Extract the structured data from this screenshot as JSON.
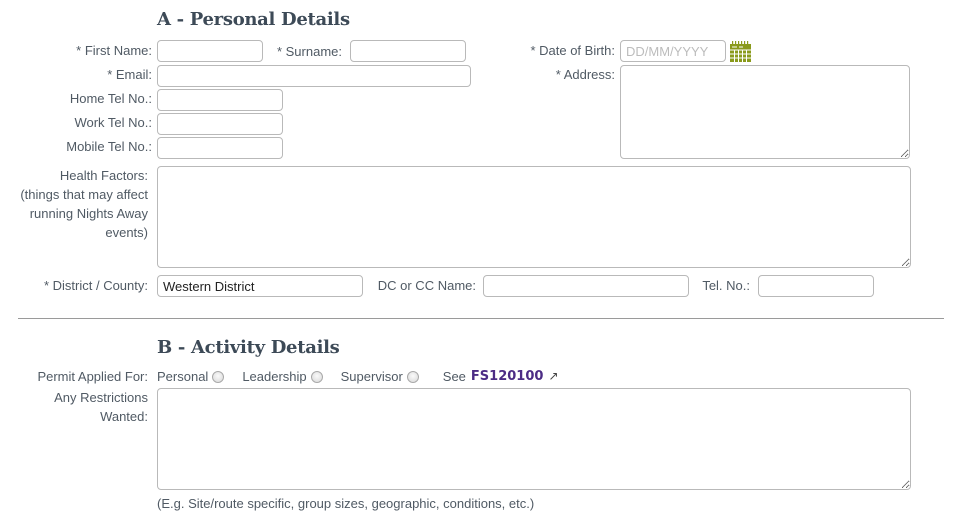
{
  "section_a": {
    "title": "A - Personal Details",
    "first_name": {
      "label": "* First Name:",
      "value": ""
    },
    "surname": {
      "label": "* Surname:",
      "value": ""
    },
    "date_of_birth": {
      "label": "* Date of Birth:",
      "value": "",
      "placeholder": "DD/MM/YYYY",
      "icon": "calendar-icon"
    },
    "email": {
      "label": "* Email:",
      "value": ""
    },
    "address": {
      "label": "* Address:",
      "value": ""
    },
    "home_tel": {
      "label": "Home Tel No.:",
      "value": ""
    },
    "work_tel": {
      "label": "Work Tel No.:",
      "value": ""
    },
    "mobile_tel": {
      "label": "Mobile Tel No.:",
      "value": ""
    },
    "health_factors": {
      "label_lines": [
        "Health Factors:",
        "(things that may affect",
        "running Nights Away",
        "events)"
      ],
      "value": ""
    },
    "district_county": {
      "label": "* District / County:",
      "value": "Western District"
    },
    "dc_cc_name": {
      "label": "DC or CC Name:",
      "value": ""
    },
    "tel_no": {
      "label": "Tel. No.:",
      "value": ""
    }
  },
  "section_b": {
    "title": "B - Activity Details",
    "permit": {
      "label": "Permit Applied For:",
      "options": [
        {
          "label": "Personal",
          "checked": false
        },
        {
          "label": "Leadership",
          "checked": false
        },
        {
          "label": "Supervisor",
          "checked": false
        }
      ],
      "see_prefix": "See",
      "see_link": "FS120100",
      "external_icon": "↗"
    },
    "restrictions": {
      "label_lines": [
        "Any Restrictions",
        "Wanted:"
      ],
      "value": "",
      "hint": "(E.g. Site/route specific, group sizes, geographic, conditions, etc.)"
    }
  },
  "colors": {
    "link": "#4c2c85",
    "calendar_icon": "#8a9a1b",
    "heading": "#3d4a57"
  }
}
